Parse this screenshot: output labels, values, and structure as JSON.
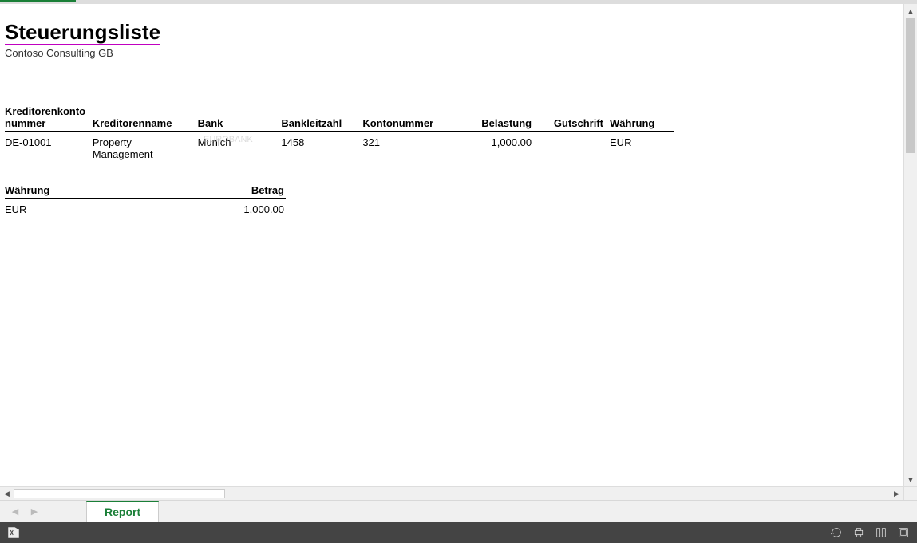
{
  "report": {
    "title": "Steuerungsliste",
    "company": "Contoso Consulting GB"
  },
  "ghost_bank": "EUROBANK",
  "main_table": {
    "headers": {
      "kreditorenkonto": "Kreditorenkontonummer",
      "kreditorenname": "Kreditorenname",
      "bank": "Bank",
      "blz": "Bankleitzahl",
      "kontonr": "Kontonummer",
      "belastung": "Belastung",
      "gutschrift": "Gutschrift",
      "waehrung": "Währung"
    },
    "rows": [
      {
        "kreditorenkonto": "DE-01001",
        "kreditorenname": "Property Management",
        "bank": "Munich",
        "blz": "1458",
        "kontonr": "321",
        "belastung": "1,000.00",
        "gutschrift": "",
        "waehrung": "EUR"
      }
    ]
  },
  "summary_table": {
    "headers": {
      "waehrung": "Währung",
      "betrag": "Betrag"
    },
    "rows": [
      {
        "waehrung": "EUR",
        "betrag": "1,000.00"
      }
    ]
  },
  "tabs": {
    "active": "Report"
  }
}
